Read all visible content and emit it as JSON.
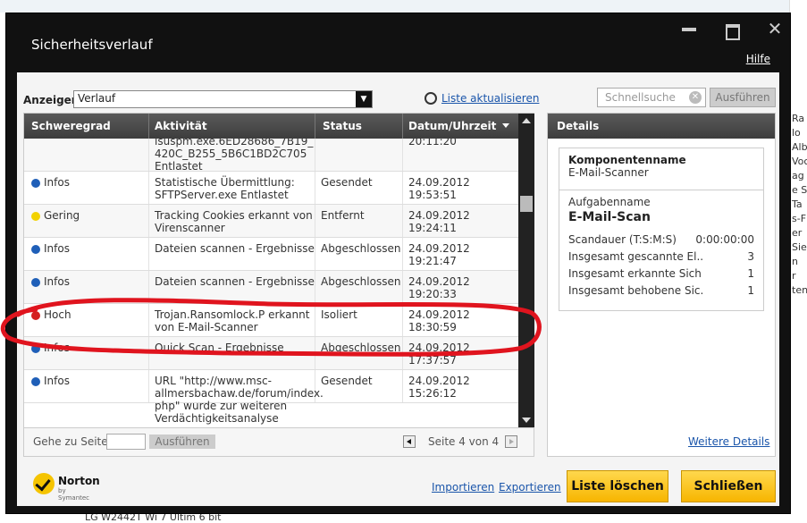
{
  "window": {
    "title": "Sicherheitsverlauf",
    "help": "Hilfe"
  },
  "toolbar": {
    "show_label": "Anzeigen",
    "show_value": "Verlauf",
    "refresh_label": "Liste aktualisieren",
    "search_placeholder": "Schnellsuche",
    "run_label": "Ausführen"
  },
  "table": {
    "columns": [
      "Schweregrad",
      "Aktivität",
      "Status",
      "Datum/Uhrzeit"
    ],
    "rows": [
      {
        "severity": "",
        "severity_color": "",
        "activity": "isuspm.exe.6ED28686_7B19_\n420C_B255_5B6C1BD2C705\nEntlastet",
        "status": "",
        "datetime": "20:11:20"
      },
      {
        "severity": "Infos",
        "severity_color": "#1f5fb8",
        "activity": "Statistische Übermittlung:\nSFTPServer.exe Entlastet",
        "status": "Gesendet",
        "datetime": "24.09.2012\n19:53:51"
      },
      {
        "severity": "Gering",
        "severity_color": "#f2d200",
        "activity": "Tracking Cookies erkannt von\nVirenscanner",
        "status": "Entfernt",
        "datetime": "24.09.2012\n19:24:11"
      },
      {
        "severity": "Infos",
        "severity_color": "#1f5fb8",
        "activity": "Dateien scannen - Ergebnisse",
        "status": "Abgeschlossen",
        "datetime": "24.09.2012\n19:21:47"
      },
      {
        "severity": "Infos",
        "severity_color": "#1f5fb8",
        "activity": "Dateien scannen - Ergebnisse",
        "status": "Abgeschlossen",
        "datetime": "24.09.2012\n19:20:33"
      },
      {
        "severity": "Hoch",
        "severity_color": "#d42020",
        "activity": "Trojan.Ransomlock.P erkannt\nvon E-Mail-Scanner",
        "status": "Isoliert",
        "datetime": "24.09.2012\n18:30:59"
      },
      {
        "severity": "Infos",
        "severity_color": "#1f5fb8",
        "activity": "Quick Scan - Ergebnisse",
        "status": "Abgeschlossen",
        "datetime": "24.09.2012\n17:37:57"
      },
      {
        "severity": "Infos",
        "severity_color": "#1f5fb8",
        "activity": "URL \"http://www.msc-\nallmersbachaw.de/forum/index.\nphp\" wurde zur weiteren\nVerdächtigkeitsanalyse",
        "status": "Gesendet",
        "datetime": "24.09.2012\n15:26:12"
      }
    ]
  },
  "pager": {
    "goto_label": "Gehe zu Seite:",
    "run_label": "Ausführen",
    "page_text": "Seite 4 von 4"
  },
  "details": {
    "header": "Details",
    "component_label": "Komponentenname",
    "component_value": "E-Mail-Scanner",
    "task_label": "Aufgabenname",
    "task_value": "E-Mail-Scan",
    "stats": [
      {
        "key": "Scandauer (T:S:M:S)",
        "value": "0:00:00:00"
      },
      {
        "key": "Insgesamt gescannte El...",
        "value": "3"
      },
      {
        "key": "Insgesamt erkannte Sich...",
        "value": "1"
      },
      {
        "key": "Insgesamt behobene Sic...",
        "value": "1"
      }
    ],
    "more": "Weitere Details"
  },
  "footer": {
    "brand": "Norton",
    "brand_sub": "by Symantec",
    "import": "Importieren",
    "export": "Exportieren",
    "clear": "Liste löschen",
    "close": "Schließen"
  },
  "background": {
    "bottom_text": "LG W2442T  Wi  7 Ultim  6 bit",
    "right_frags": [
      "Ra",
      "lo",
      "Albe",
      "Voc",
      "ag",
      "e Sie",
      "Ta",
      "s-F",
      "er",
      "Sie",
      "n",
      "r",
      "ten"
    ]
  },
  "colors": {
    "accent_yellow": "#f7b500",
    "link_blue": "#1a55aa",
    "annotation_red": "#e0141e"
  }
}
